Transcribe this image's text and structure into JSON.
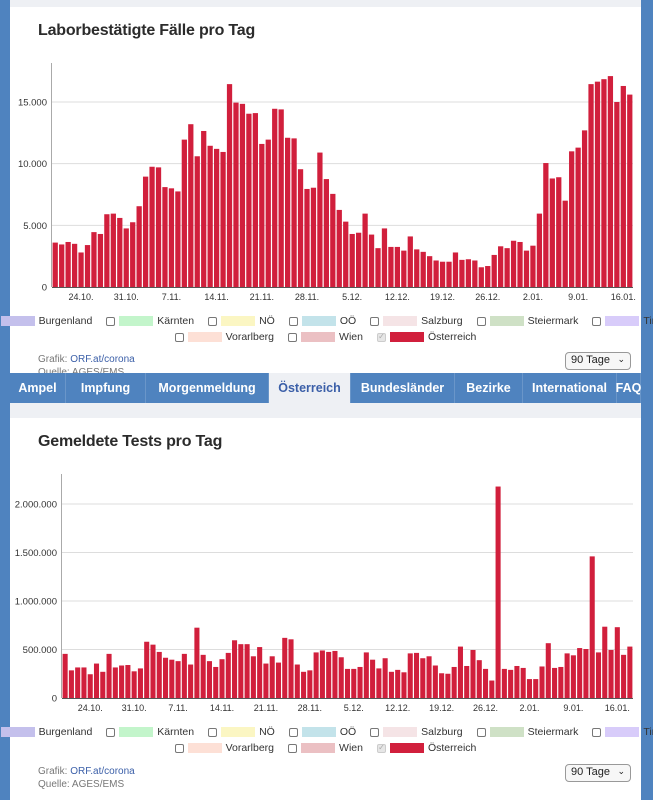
{
  "tabs": [
    {
      "label": "Ampel",
      "active": false
    },
    {
      "label": "Impfung",
      "active": false
    },
    {
      "label": "Morgenmeldung",
      "active": false
    },
    {
      "label": "Österreich",
      "active": true
    },
    {
      "label": "Bundesländer",
      "active": false
    },
    {
      "label": "Bezirke",
      "active": false
    },
    {
      "label": "International",
      "active": false
    },
    {
      "label": "FAQ",
      "active": false
    }
  ],
  "legend": [
    {
      "label": "Burgenland",
      "color": "#c4c0ec",
      "checked": false
    },
    {
      "label": "Kärnten",
      "color": "#c3f5cb",
      "checked": false
    },
    {
      "label": "NÖ",
      "color": "#fbf6c3",
      "checked": false
    },
    {
      "label": "OÖ",
      "color": "#c3e3ea",
      "checked": false
    },
    {
      "label": "Salzburg",
      "color": "#f5e4e6",
      "checked": false
    },
    {
      "label": "Steiermark",
      "color": "#cfe1c6",
      "checked": false
    },
    {
      "label": "Tirol",
      "color": "#d8ccfa",
      "checked": false
    },
    {
      "label": "Vorarlberg",
      "color": "#fde0d6",
      "checked": false
    },
    {
      "label": "Wien",
      "color": "#ebc0c3",
      "checked": false
    },
    {
      "label": "Österreich",
      "color": "#d11f3c",
      "checked": true
    }
  ],
  "footer": {
    "grafik_label": "Grafik:",
    "grafik_link": "ORF.at/corona",
    "quelle": "Quelle: AGES/EMS"
  },
  "range_select": {
    "value": "90 Tage"
  },
  "bar_color": "#d11f3c",
  "chart_data": [
    {
      "type": "bar",
      "title": "Laborbestätigte Fälle pro Tag",
      "xlabel": "",
      "ylabel": "",
      "ylim": [
        0,
        18000
      ],
      "yticks": [
        0,
        5000,
        10000,
        15000
      ],
      "ytick_labels": [
        "0",
        "5.000",
        "10.000",
        "15.000"
      ],
      "grid": true,
      "xtick_labels": [
        "24.10.",
        "31.10.",
        "7.11.",
        "14.11.",
        "21.11.",
        "28.11.",
        "5.12.",
        "12.12.",
        "19.12.",
        "26.12.",
        "2.01.",
        "9.01.",
        "16.01."
      ],
      "xtick_index": [
        4,
        11,
        18,
        25,
        32,
        39,
        46,
        53,
        60,
        67,
        74,
        81,
        88
      ],
      "series": [
        {
          "name": "Österreich",
          "values": [
            3600,
            3450,
            3650,
            3500,
            2800,
            3400,
            4450,
            4300,
            5900,
            5950,
            5600,
            4750,
            5250,
            6550,
            8950,
            9750,
            9700,
            8100,
            8000,
            7750,
            11950,
            13200,
            10600,
            12650,
            11450,
            11200,
            10950,
            16450,
            14950,
            14850,
            14050,
            14100,
            11600,
            11950,
            14450,
            14400,
            12100,
            12050,
            9550,
            7950,
            8050,
            10900,
            8750,
            7550,
            6250,
            5300,
            4300,
            4400,
            5950,
            4250,
            3150,
            4750,
            3250,
            3250,
            2950,
            4100,
            3050,
            2850,
            2500,
            2150,
            2050,
            2050,
            2800,
            2200,
            2250,
            2150,
            1600,
            1700,
            2600,
            3300,
            3150,
            3750,
            3650,
            2950,
            3350,
            5950,
            10050,
            8800,
            8900,
            7000,
            11000,
            11300,
            12700,
            16450,
            16650,
            16850,
            17100,
            15000,
            16300,
            15600
          ]
        }
      ]
    },
    {
      "type": "bar",
      "title": "Gemeldete Tests pro Tag",
      "xlabel": "",
      "ylabel": "",
      "ylim": [
        0,
        2300000
      ],
      "yticks": [
        0,
        500000,
        1000000,
        1500000,
        2000000
      ],
      "ytick_labels": [
        "0",
        "500.000",
        "1.000.000",
        "1.500.000",
        "2.000.000"
      ],
      "grid": true,
      "xtick_labels": [
        "24.10.",
        "31.10.",
        "7.11.",
        "14.11.",
        "21.11.",
        "28.11.",
        "5.12.",
        "12.12.",
        "19.12.",
        "26.12.",
        "2.01.",
        "9.01.",
        "16.01."
      ],
      "xtick_index": [
        4,
        11,
        18,
        25,
        32,
        39,
        46,
        53,
        60,
        67,
        74,
        81,
        88
      ],
      "series": [
        {
          "name": "Österreich",
          "values": [
            455000,
            285000,
            315000,
            315000,
            245000,
            355000,
            270000,
            455000,
            315000,
            335000,
            340000,
            275000,
            305000,
            580000,
            550000,
            475000,
            415000,
            395000,
            380000,
            455000,
            345000,
            725000,
            445000,
            380000,
            320000,
            400000,
            465000,
            595000,
            555000,
            555000,
            430000,
            525000,
            355000,
            430000,
            365000,
            620000,
            605000,
            345000,
            270000,
            285000,
            470000,
            490000,
            475000,
            485000,
            420000,
            300000,
            300000,
            320000,
            470000,
            395000,
            305000,
            410000,
            270000,
            290000,
            265000,
            460000,
            465000,
            410000,
            430000,
            335000,
            255000,
            250000,
            320000,
            530000,
            330000,
            495000,
            390000,
            300000,
            180000,
            2180000,
            300000,
            290000,
            330000,
            310000,
            195000,
            195000,
            325000,
            565000,
            310000,
            320000,
            460000,
            440000,
            515000,
            505000,
            1460000,
            470000,
            735000,
            495000,
            730000,
            445000,
            530000
          ]
        }
      ]
    }
  ]
}
